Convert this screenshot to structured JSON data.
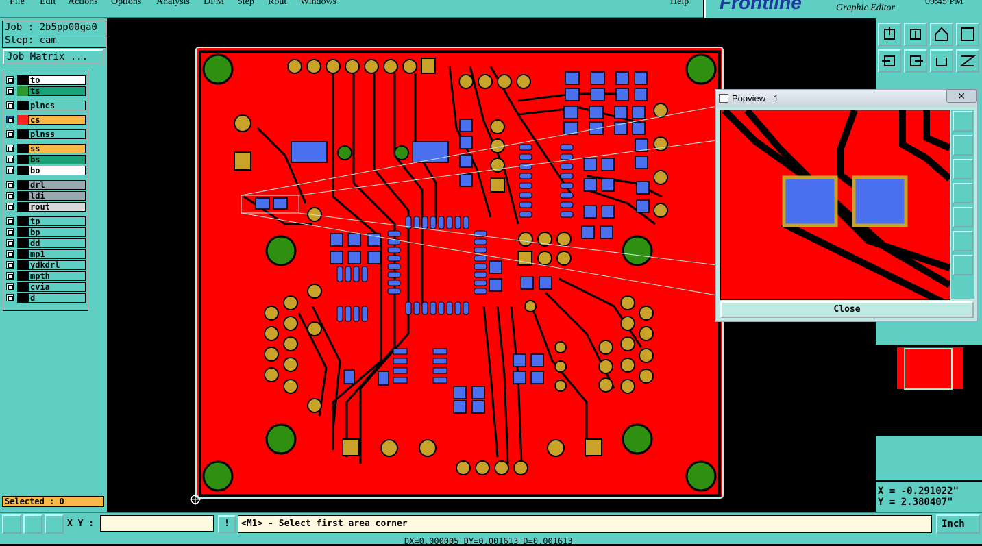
{
  "menu": [
    "File",
    "Edit",
    "Actions",
    "Options",
    "Analysis",
    "DFM",
    "Step",
    "Rout",
    "Windows"
  ],
  "help": "Help",
  "logo": {
    "brand": "Frontline",
    "sub": "Graphic Editor",
    "clock": "09:45 PM"
  },
  "job": {
    "job_label": "Job : 2b5pp00ga0",
    "step_label": "Step: cam",
    "matrix_button": "Job Matrix ..."
  },
  "layers": [
    {
      "name": "to",
      "color": "#ffffff",
      "swatch": "#000000"
    },
    {
      "name": "ts",
      "color": "#1aa37a",
      "swatch": "#2e9a2e"
    },
    {
      "name": "plncs",
      "color": "#5fcfc3",
      "swatch": "#000000"
    },
    {
      "name": "cs",
      "color": "#f9b948",
      "swatch": "#ff2020",
      "active": true
    },
    {
      "name": "plnss",
      "color": "#5fcfc3",
      "swatch": "#000000"
    },
    {
      "name": "ss",
      "color": "#f9b948",
      "swatch": "#000000"
    },
    {
      "name": "bs",
      "color": "#1aa37a",
      "swatch": "#000000"
    },
    {
      "name": "bo",
      "color": "#ffffff",
      "swatch": "#000000"
    },
    {
      "name": "drl",
      "color": "#9aa8b0",
      "swatch": "#000000"
    },
    {
      "name": "ldi",
      "color": "#9aa8b0",
      "swatch": "#000000"
    },
    {
      "name": "rout",
      "color": "#d8d8d8",
      "swatch": "#000000"
    },
    {
      "name": "tp",
      "color": "#5fcfc3",
      "swatch": "#000000"
    },
    {
      "name": "bp",
      "color": "#5fcfc3",
      "swatch": "#000000"
    },
    {
      "name": "dd",
      "color": "#5fcfc3",
      "swatch": "#000000"
    },
    {
      "name": "mp1",
      "color": "#5fcfc3",
      "swatch": "#000000"
    },
    {
      "name": "ydkdrl",
      "color": "#5fcfc3",
      "swatch": "#000000"
    },
    {
      "name": "mpth",
      "color": "#5fcfc3",
      "swatch": "#000000"
    },
    {
      "name": "cvia",
      "color": "#5fcfc3",
      "swatch": "#000000"
    },
    {
      "name": "d",
      "color": "#5fcfc3",
      "swatch": "#000000"
    }
  ],
  "selected": "Selected : 0",
  "popup": {
    "title": "Popview - 1",
    "close_x": "✕",
    "close_button": "Close"
  },
  "coords": {
    "x": "X = -0.291022\"",
    "y": "Y = 2.380407\""
  },
  "bottom": {
    "xy_label": "X Y :",
    "xy_value": "",
    "prompt": "<M1> - Select first area corner",
    "unit": "Inch",
    "info": "DX=0.000005 DY=0.001613 D=0.001613"
  },
  "colors": {
    "panel": "#5fcfc3",
    "copper": "#ff0000",
    "pad_blue": "#4a6fef",
    "pad_gold": "#c9a22a",
    "via_green": "#2e8f10"
  }
}
